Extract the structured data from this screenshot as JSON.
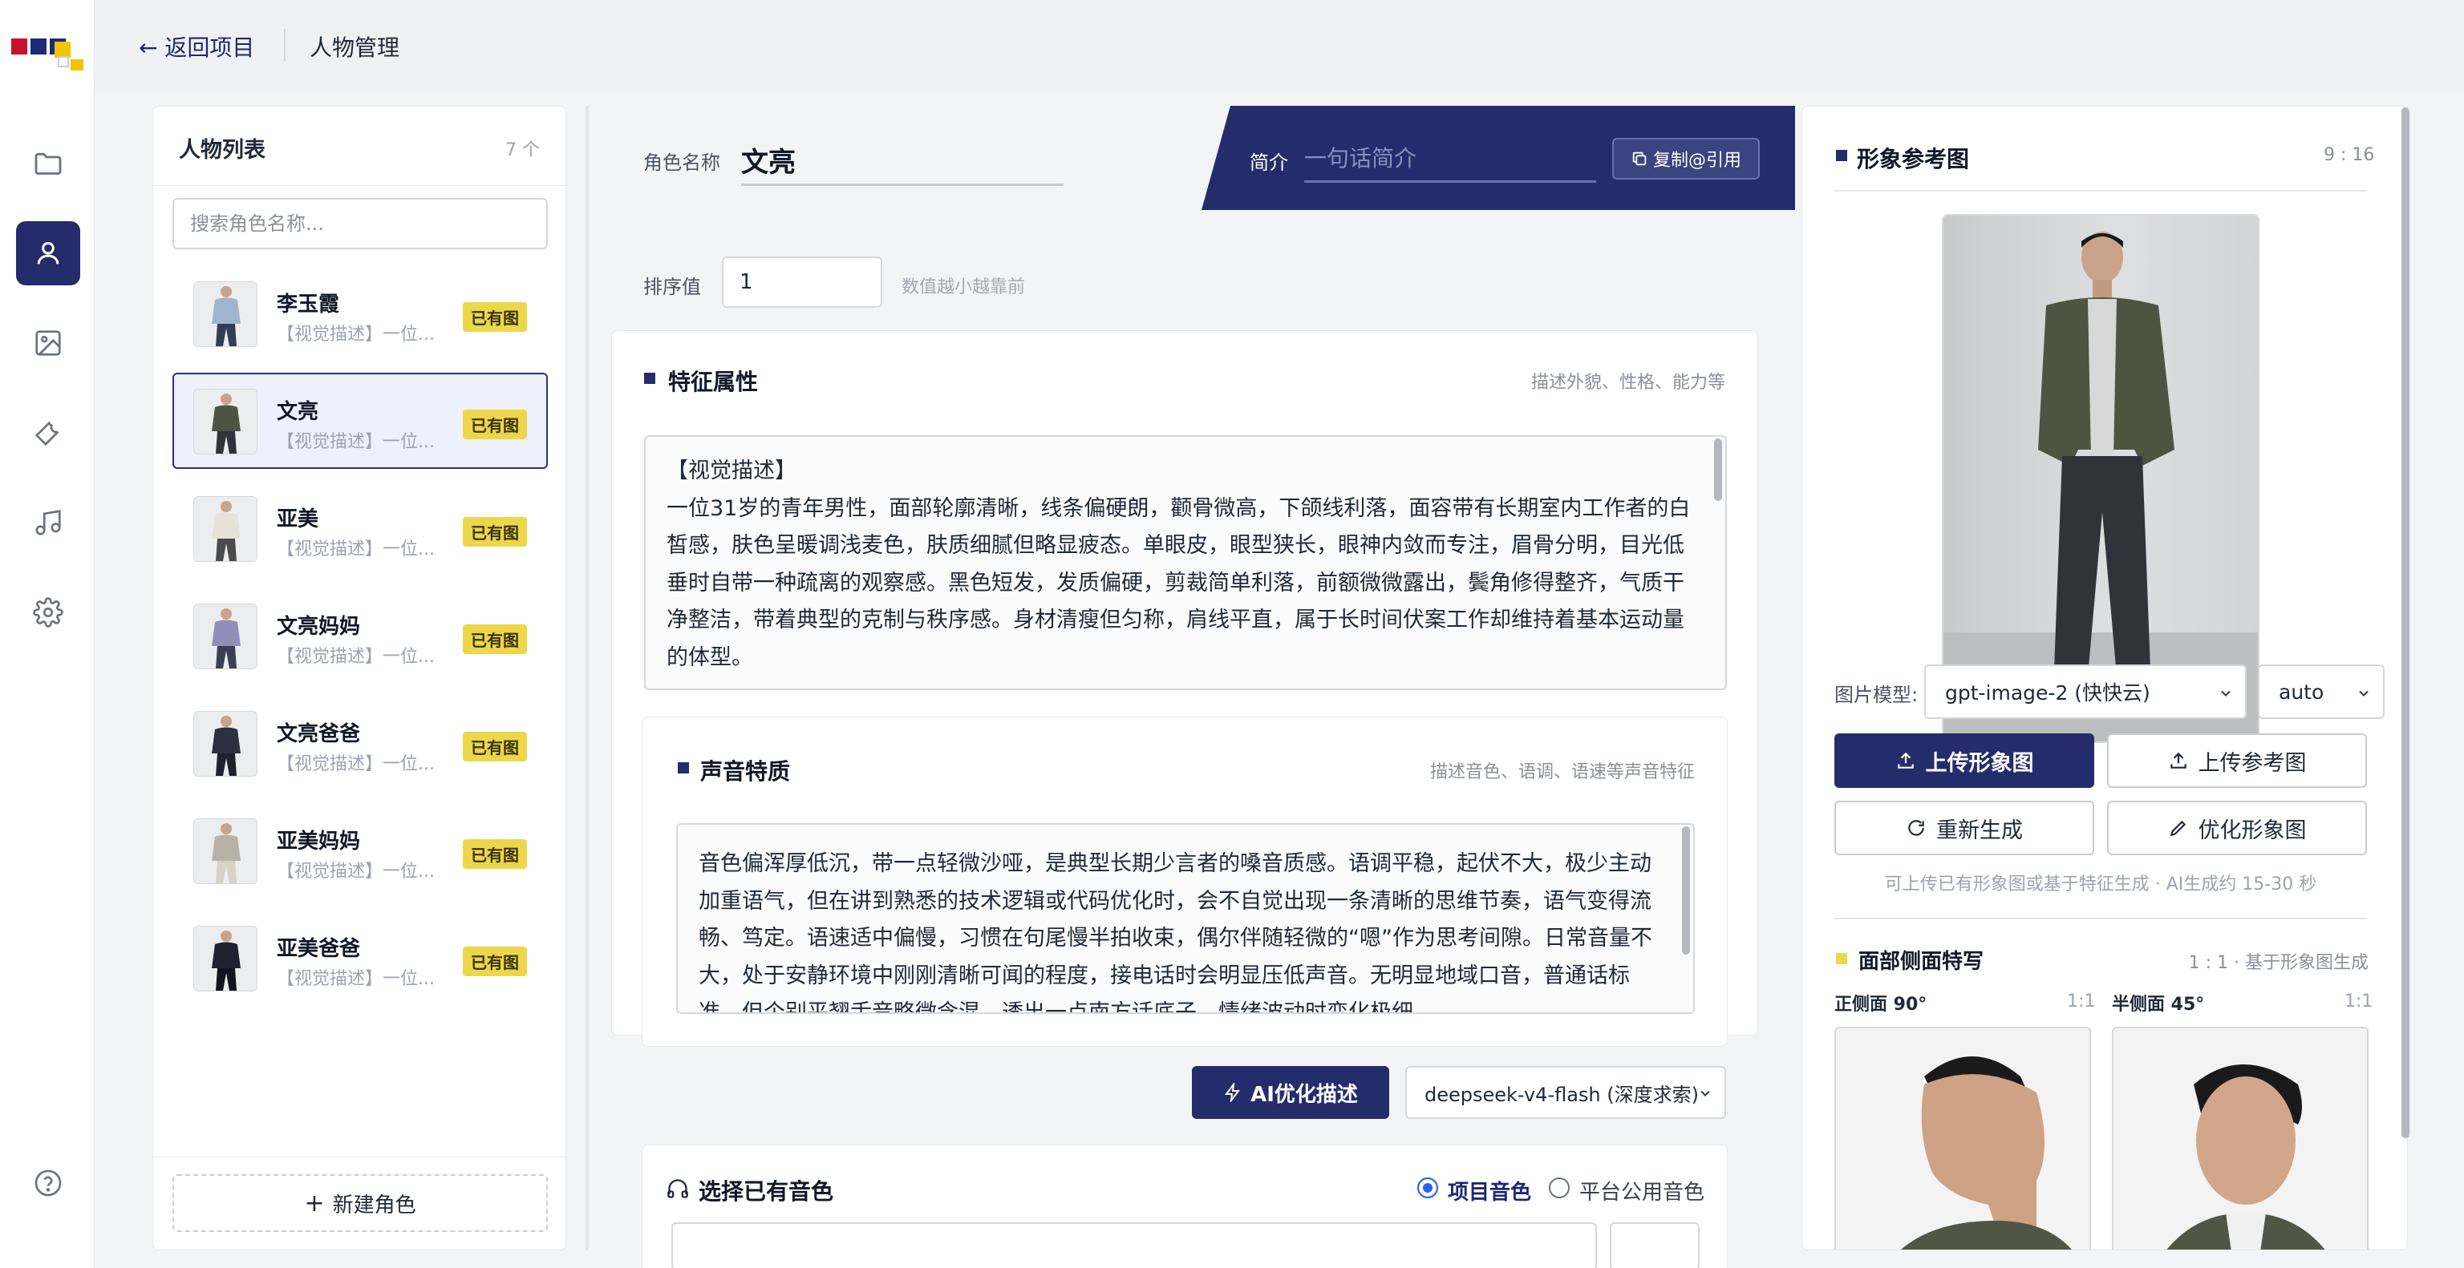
{
  "header": {
    "back_label": "← 返回项目",
    "title": "人物管理"
  },
  "character_list": {
    "title": "人物列表",
    "count": "7 个",
    "search_placeholder": "搜索角色名称...",
    "new_role_label": "新建角色",
    "items": [
      {
        "name": "李玉霞",
        "desc": "【视觉描述】一位...",
        "badge": "已有图",
        "active": false
      },
      {
        "name": "文亮",
        "desc": "【视觉描述】一位...",
        "badge": "已有图",
        "active": true
      },
      {
        "name": "亚美",
        "desc": "【视觉描述】一位...",
        "badge": "已有图",
        "active": false
      },
      {
        "name": "文亮妈妈",
        "desc": "【视觉描述】一位...",
        "badge": "已有图",
        "active": false
      },
      {
        "name": "文亮爸爸",
        "desc": "【视觉描述】一位...",
        "badge": "已有图",
        "active": false
      },
      {
        "name": "亚美妈妈",
        "desc": "【视觉描述】一位...",
        "badge": "已有图",
        "active": false
      },
      {
        "name": "亚美爸爸",
        "desc": "【视觉描述】一位...",
        "badge": "已有图",
        "active": false
      }
    ]
  },
  "editor": {
    "name_label": "角色名称",
    "name_value": "文亮",
    "intro_label": "简介",
    "intro_placeholder": "一句话简介",
    "copy_ref_label": "复制@引用",
    "sort_label": "排序值",
    "sort_value": "1",
    "sort_hint": "数值越小越靠前",
    "features": {
      "title": "特征属性",
      "hint": "描述外貌、性格、能力等",
      "text": "【视觉描述】\n一位31岁的青年男性，面部轮廓清晰，线条偏硬朗，颧骨微高，下颌线利落，面容带有长期室内工作者的白皙感，肤色呈暖调浅麦色，肤质细腻但略显疲态。单眼皮，眼型狭长，眼神内敛而专注，眉骨分明，目光低垂时自带一种疏离的观察感。黑色短发，发质偏硬，剪裁简单利落，前额微微露出，鬓角修得整齐，气质干净整洁，带着典型的克制与秩序感。身材清瘦但匀称，肩线平直，属于长时间伏案工作却维持着基本运动量的体型。"
    },
    "voice": {
      "title": "声音特质",
      "hint": "描述音色、语调、语速等声音特征",
      "text": "音色偏浑厚低沉，带一点轻微沙哑，是典型长期少言者的嗓音质感。语调平稳，起伏不大，极少主动加重语气，但在讲到熟悉的技术逻辑或代码优化时，会不自觉出现一条清晰的思维节奏，语气变得流畅、笃定。语速适中偏慢，习惯在句尾慢半拍收束，偶尔伴随轻微的“嗯”作为思考间隙。日常音量不大，处于安静环境中刚刚清晰可闻的程度，接电话时会明显压低声音。无明显地域口音，普通话标准，但个别平翘舌音略微含混，透出一点南方话底子，情绪波动时变化极细"
    },
    "ai_optimize_label": "AI优化描述",
    "model_value": "deepseek-v4-flash (深度求索)",
    "voice_pick": {
      "title": "选择已有音色",
      "option_project": "项目音色",
      "option_public": "平台公用音色"
    }
  },
  "reference": {
    "title": "形象参考图",
    "ratio": "9 : 16",
    "image_model_label": "图片模型:",
    "image_model_value": "gpt-image-2 (快快云)",
    "size_value": "auto",
    "upload_image_label": "上传形象图",
    "upload_ref_label": "上传参考图",
    "regenerate_label": "重新生成",
    "optimize_image_label": "优化形象图",
    "hint": "可上传已有形象图或基于特征生成 · AI生成约 15-30 秒",
    "side_title": "面部侧面特写",
    "side_hint": "1 : 1 · 基于形象图生成",
    "side_front_label": "正侧面 90°",
    "side_front_ratio": "1:1",
    "side_half_label": "半侧面 45°",
    "side_half_ratio": "1:1"
  },
  "colors": {
    "primary": "#242c6b",
    "badge": "#ecd74a",
    "accent_radio": "#2563eb"
  }
}
